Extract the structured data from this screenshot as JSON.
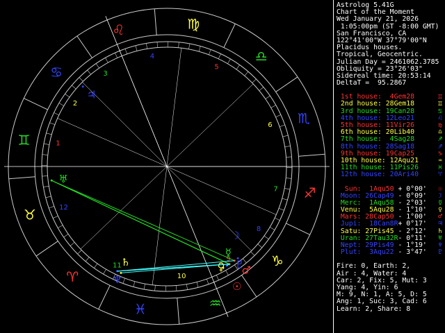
{
  "app": {
    "name": "Astrolog 5.41G"
  },
  "header": [
    "Astrolog 5.41G",
    "Chart of the Moment",
    "Wed January 21, 2026",
    " 1:05:00pm (ST -8:00 GMT)",
    "San Francisco, CA",
    "122°41'00\"W 37°79'00\"N",
    "Placidus houses.",
    "Tropical, Geocentric.",
    "Julian Day = 2461062.3785",
    "Obliquity = 23°26'03\"",
    "Sidereal time: 20:53:14",
    "DeltaT =  95.2867"
  ],
  "houses": [
    {
      "label": "1st house:  4Gem28",
      "color": "#ff3333",
      "sign": "♊"
    },
    {
      "label": "2nd house: 28Gem18",
      "color": "#ffff44",
      "sign": "♊"
    },
    {
      "label": "3rd house: 19Can28",
      "color": "#22dd22",
      "sign": "♋"
    },
    {
      "label": "4th house: 12Leo21",
      "color": "#3344ff",
      "sign": "♌"
    },
    {
      "label": "5th house: 11Vir26",
      "color": "#ff3333",
      "sign": "♍"
    },
    {
      "label": "6th house: 20Lib40",
      "color": "#ffff44",
      "sign": "♎"
    },
    {
      "label": "7th house:  4Sag28",
      "color": "#22dd22",
      "sign": "♐"
    },
    {
      "label": "8th house: 28Sag18",
      "color": "#3344ff",
      "sign": "♐"
    },
    {
      "label": "9th house: 19Cap25",
      "color": "#ff3333",
      "sign": "♑"
    },
    {
      "label": "10th house: 12Aqu21",
      "color": "#ffff44",
      "sign": "♒"
    },
    {
      "label": "11th house: 11Pis26",
      "color": "#22dd22",
      "sign": "♓"
    },
    {
      "label": "12th house: 20Ari40",
      "color": "#3344ff",
      "sign": "♈"
    }
  ],
  "planets": [
    {
      "name": "Sun:",
      "pos": "1Aqu50",
      "r": " ",
      "lat": "+ 0°00'",
      "color": "#ff3333",
      "glyph": "☉"
    },
    {
      "name": "Moon:",
      "pos": "26Cap49",
      "r": " ",
      "lat": "- 0°09'",
      "color": "#3344ff",
      "glyph": "☽"
    },
    {
      "name": "Merc:",
      "pos": "1Aqu58",
      "r": " ",
      "lat": "- 2°03'",
      "color": "#22dd22",
      "glyph": "☿"
    },
    {
      "name": "Venu:",
      "pos": "5Aqu28",
      "r": " ",
      "lat": "- 1°10'",
      "color": "#ffff44",
      "glyph": "♀"
    },
    {
      "name": "Mars:",
      "pos": "28Cap50",
      "r": " ",
      "lat": "- 1°00'",
      "color": "#ff3333",
      "glyph": "♂"
    },
    {
      "name": "Jupi:",
      "pos": "18Can8",
      "r": "R",
      "lat": "+ 0°17'",
      "color": "#3344ff",
      "glyph": "♃"
    },
    {
      "name": "Satu:",
      "pos": "27Pis45",
      "r": " ",
      "lat": "- 2°12'",
      "color": "#ffff44",
      "glyph": "♄"
    },
    {
      "name": "Uran:",
      "pos": "27Tau32",
      "r": "R",
      "lat": "- 0°11'",
      "color": "#22dd22",
      "glyph": "♅"
    },
    {
      "name": "Nept:",
      "pos": "29Pis49",
      "r": " ",
      "lat": "- 1°19'",
      "color": "#3344ff",
      "glyph": "♆"
    },
    {
      "name": "Plut:",
      "pos": "3Aqu22",
      "r": " ",
      "lat": "- 3°47'",
      "color": "#3344ff",
      "glyph": "♇"
    }
  ],
  "stats": [
    "Fire: 0, Earth: 2,",
    "Air : 4, Water: 4",
    "Car: 2, Fix: 5, Mut: 3",
    "Yang: 4, Yin: 6",
    "M: 9, N: 1, A: 5, D: 5",
    "Ang: 1, Suc: 3, Cad: 6",
    "Learn: 2, Share: 8"
  ],
  "wheel": {
    "signs": [
      {
        "glyph": "♈",
        "color": "#ff3333"
      },
      {
        "glyph": "♉",
        "color": "#ffff44"
      },
      {
        "glyph": "♊",
        "color": "#22dd22"
      },
      {
        "glyph": "♋",
        "color": "#3344ff"
      },
      {
        "glyph": "♌",
        "color": "#ff3333"
      },
      {
        "glyph": "♍",
        "color": "#ffff44"
      },
      {
        "glyph": "♎",
        "color": "#22dd22"
      },
      {
        "glyph": "♏",
        "color": "#3344ff"
      },
      {
        "glyph": "♐",
        "color": "#ff3333"
      },
      {
        "glyph": "♑",
        "color": "#ffff44"
      },
      {
        "glyph": "♒",
        "color": "#22dd22"
      },
      {
        "glyph": "♓",
        "color": "#3344ff"
      }
    ],
    "house_numbers": [
      "1",
      "2",
      "3",
      "4",
      "5",
      "6",
      "7",
      "8",
      "9",
      "10",
      "11",
      "12"
    ],
    "house_number_colors": [
      "#ff3333",
      "#ffff44",
      "#22dd22",
      "#3344ff",
      "#ff3333",
      "#ffff44",
      "#22dd22",
      "#3344ff",
      "#ff3333",
      "#ffff44",
      "#22dd22",
      "#3344ff"
    ]
  }
}
